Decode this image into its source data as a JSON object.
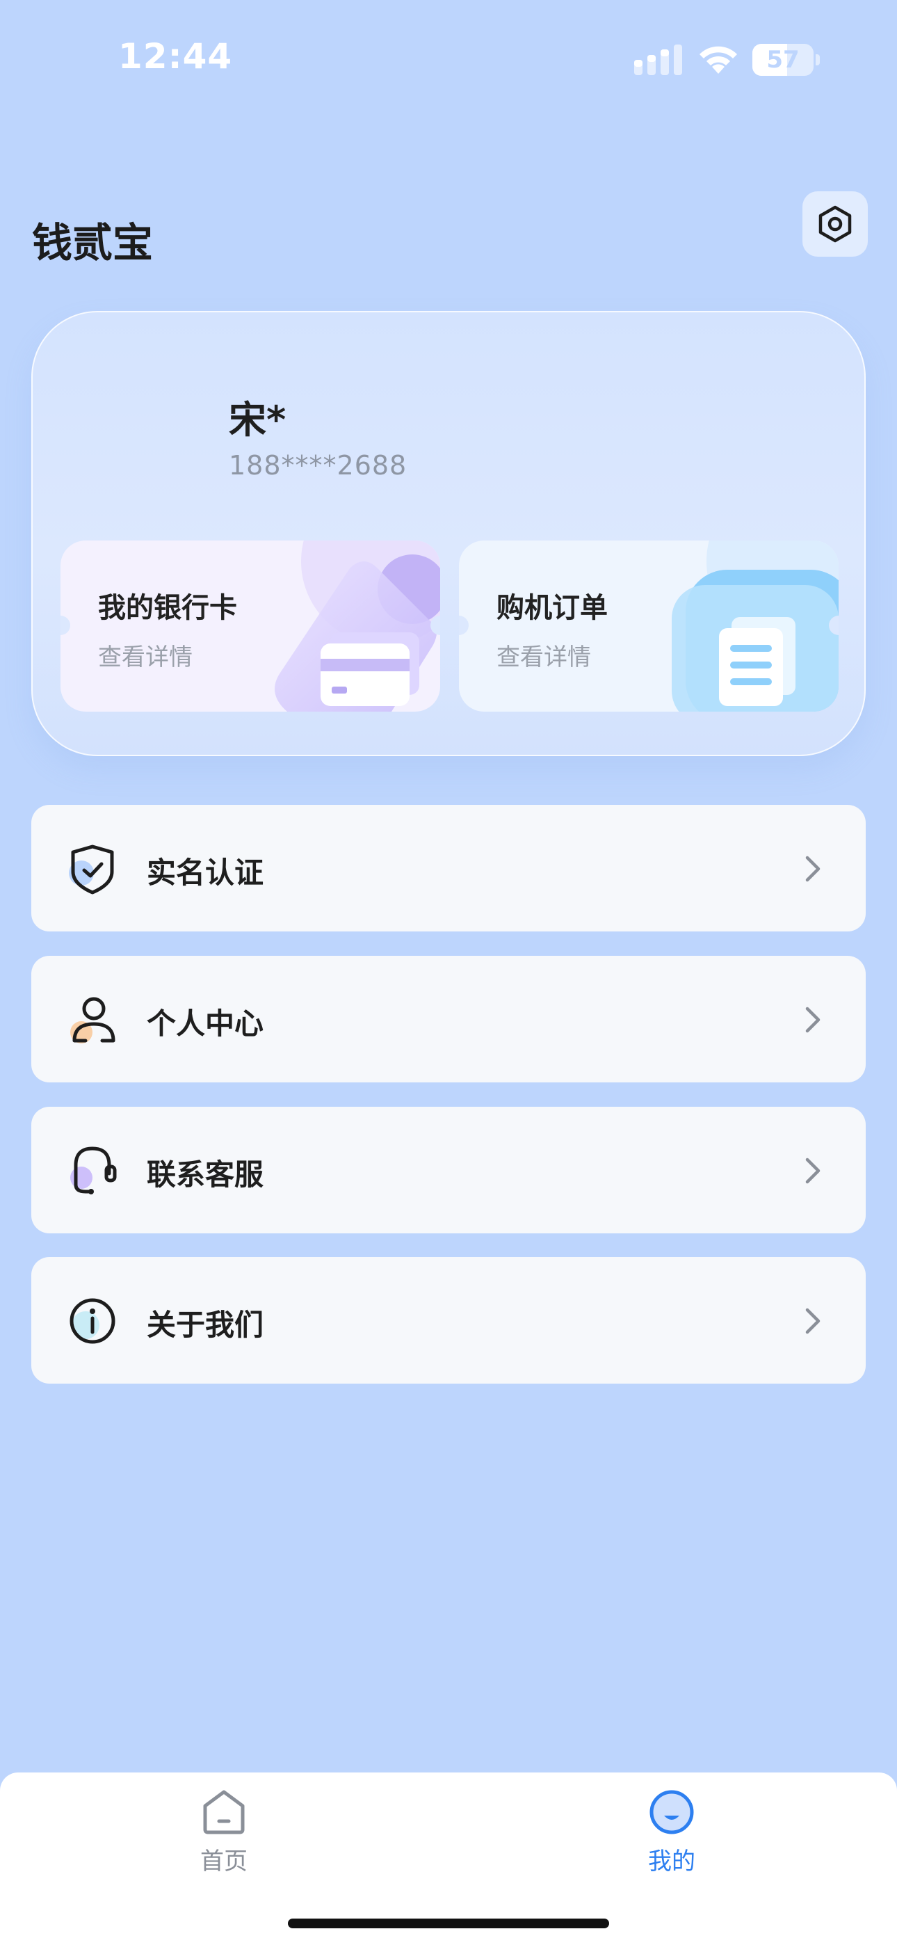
{
  "status_bar": {
    "time": "12:44",
    "battery_level": "57",
    "battery_fraction": 0.57
  },
  "header": {
    "app_title": "钱贰宝",
    "settings_icon": "settings-icon"
  },
  "profile": {
    "name": "宋*",
    "phone": "188****2688"
  },
  "shortcuts": [
    {
      "title": "我的银行卡",
      "subtitle": "查看详情",
      "icon": "bank-card-icon"
    },
    {
      "title": "购机订单",
      "subtitle": "查看详情",
      "icon": "order-document-icon"
    }
  ],
  "menu": [
    {
      "label": "实名认证",
      "icon": "shield-check-icon"
    },
    {
      "label": "个人中心",
      "icon": "person-icon"
    },
    {
      "label": "联系客服",
      "icon": "headset-icon"
    },
    {
      "label": "关于我们",
      "icon": "info-icon"
    }
  ],
  "tab_bar": {
    "tabs": [
      {
        "label": "首页",
        "icon": "home-icon",
        "active": false
      },
      {
        "label": "我的",
        "icon": "profile-smile-icon",
        "active": true
      }
    ]
  },
  "colors": {
    "background": "#bdd5fd",
    "accent": "#2d7ff0",
    "card": "#f6f8fb"
  }
}
